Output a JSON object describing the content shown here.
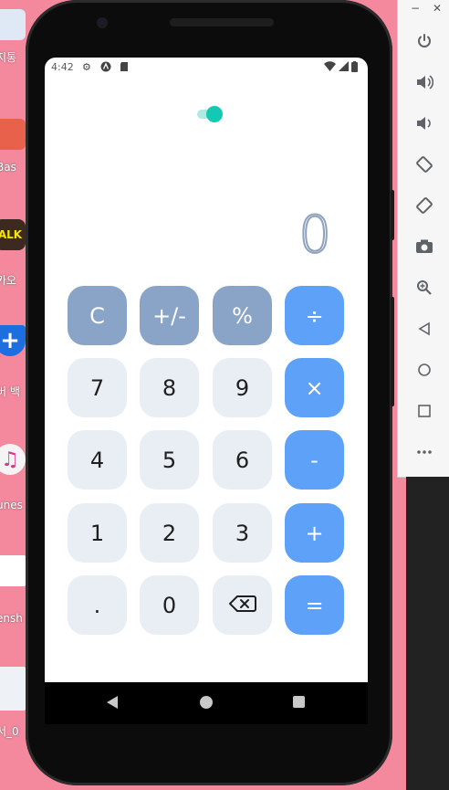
{
  "desktop": {
    "icons": [
      {
        "name": "recycle-bin-icon",
        "label": "지통",
        "color": "#3b7dd8"
      },
      {
        "name": "bas-app-icon",
        "label": "Bas",
        "color": "#e8624b"
      },
      {
        "name": "kakaotalk-icon",
        "label": "카오",
        "color": "#f7e600",
        "text": "ALK"
      },
      {
        "name": "vaccine-icon",
        "label": "버 백",
        "color": "#1d6fe0"
      },
      {
        "name": "itunes-icon",
        "label": "unes",
        "color": "#f0f0f0"
      },
      {
        "name": "screenshot-file-icon",
        "label": "ensh",
        "color": "#2a8ce0"
      },
      {
        "name": "document-file-icon",
        "label": "서_0",
        "color": "#e8eef5"
      }
    ]
  },
  "toolbar": {
    "minimize": "−",
    "close": "✕",
    "buttons": [
      "power",
      "volume-up",
      "volume-down",
      "rotate-left",
      "rotate-right",
      "camera",
      "zoom",
      "back",
      "home",
      "overview",
      "more"
    ]
  },
  "status": {
    "time": "4:42"
  },
  "calculator": {
    "display": "0",
    "keys": [
      {
        "label": "C",
        "type": "fn"
      },
      {
        "label": "+/-",
        "type": "fn"
      },
      {
        "label": "%",
        "type": "fn"
      },
      {
        "label": "÷",
        "type": "op"
      },
      {
        "label": "7",
        "type": "num"
      },
      {
        "label": "8",
        "type": "num"
      },
      {
        "label": "9",
        "type": "num"
      },
      {
        "label": "×",
        "type": "op"
      },
      {
        "label": "4",
        "type": "num"
      },
      {
        "label": "5",
        "type": "num"
      },
      {
        "label": "6",
        "type": "num"
      },
      {
        "label": "-",
        "type": "op"
      },
      {
        "label": "1",
        "type": "num"
      },
      {
        "label": "2",
        "type": "num"
      },
      {
        "label": "3",
        "type": "num"
      },
      {
        "label": "+",
        "type": "op"
      },
      {
        "label": ".",
        "type": "num"
      },
      {
        "label": "0",
        "type": "num"
      },
      {
        "label": "",
        "type": "num",
        "icon": "backspace-icon"
      },
      {
        "label": "=",
        "type": "op"
      }
    ]
  }
}
